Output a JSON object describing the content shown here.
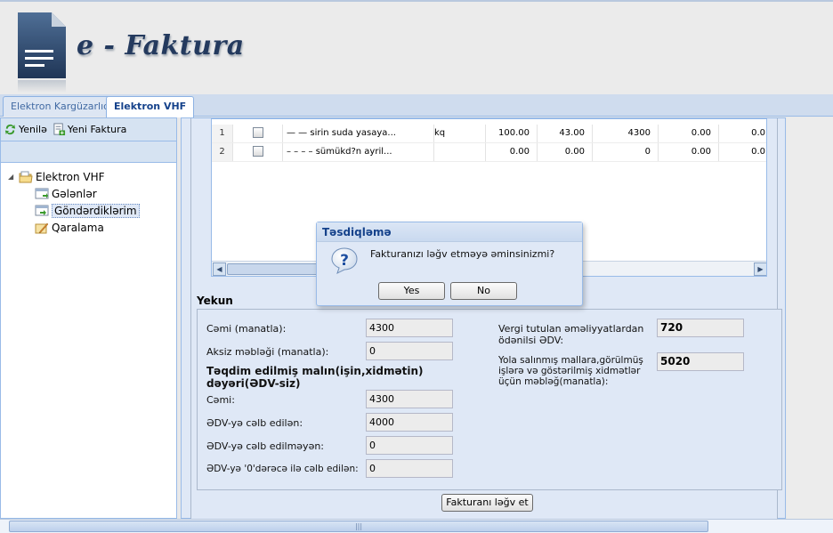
{
  "app": {
    "title": "e - Faktura"
  },
  "tabs": [
    {
      "label": "Elektron Kargüzarlıq",
      "active": false
    },
    {
      "label": "Elektron VHF",
      "active": true
    }
  ],
  "left_toolbar": {
    "refresh_label": "Yenilə",
    "new_invoice_label": "Yeni Faktura"
  },
  "tree": {
    "root": "Elektron VHF",
    "children": [
      {
        "label": "Gələnlər",
        "selected": false
      },
      {
        "label": "Göndərdiklərim",
        "selected": true
      },
      {
        "label": "Qaralama",
        "selected": false
      }
    ]
  },
  "grid": {
    "rows": [
      {
        "num": "1",
        "name": "— — sirin suda yasaya...",
        "unit": "kq",
        "c1": "100.00",
        "c2": "43.00",
        "c3": "4300",
        "c4": "0.00",
        "c5": "0.0"
      },
      {
        "num": "2",
        "name": "– – – – sümükd?n ayril...",
        "unit": "",
        "c1": "0.00",
        "c2": "0.00",
        "c3": "0",
        "c4": "0.00",
        "c5": "0.0"
      }
    ]
  },
  "yekun": {
    "title": "Yekun",
    "cemi_label": "Cəmi (manatla):",
    "cemi_value": "4300",
    "aksiz_label": "Aksiz məbləği (manatla):",
    "aksiz_value": "0",
    "section_label": "Təqdim edilmiş malın(işin,xidmətin) dəyəri(ƏDV-siz)",
    "cemi2_label": "Cəmi:",
    "cemi2_value": "4300",
    "edv_celb_label": "ƏDV-yə cəlb edilən:",
    "edv_celb_value": "4000",
    "edv_celb_olmayan_label": "ƏDV-yə cəlb edilməyən:",
    "edv_celb_olmayan_value": "0",
    "edv_sifir_label": "ƏDV-yə '0'dərəcə ilə cəlb edilən:",
    "edv_sifir_value": "0",
    "vergi_label": "Vergi tutulan əməliyyatlardan ödənilsi ƏDV:",
    "vergi_value": "720",
    "yola_label": "Yola salınmış mallara,görülmüş işlərə və göstərilmiş xidmətlər üçün məbləğ(manatla):",
    "yola_value": "5020"
  },
  "cancel_button": "Fakturanı ləğv et",
  "dialog": {
    "title": "Təsdiqləmə",
    "message": "Fakturanızı ləğv etməyə əminsinizmi?",
    "yes": "Yes",
    "no": "No"
  },
  "icons": {
    "logo": "document-icon",
    "refresh": "refresh-icon",
    "new": "new-invoice-icon",
    "folder": "folder-icon",
    "inbox": "inbox-icon",
    "sent": "sent-icon",
    "draft": "draft-icon",
    "question": "question-icon"
  },
  "colors": {
    "accent": "#15428b",
    "panel": "#dfe8f6",
    "border": "#99bbe8"
  }
}
